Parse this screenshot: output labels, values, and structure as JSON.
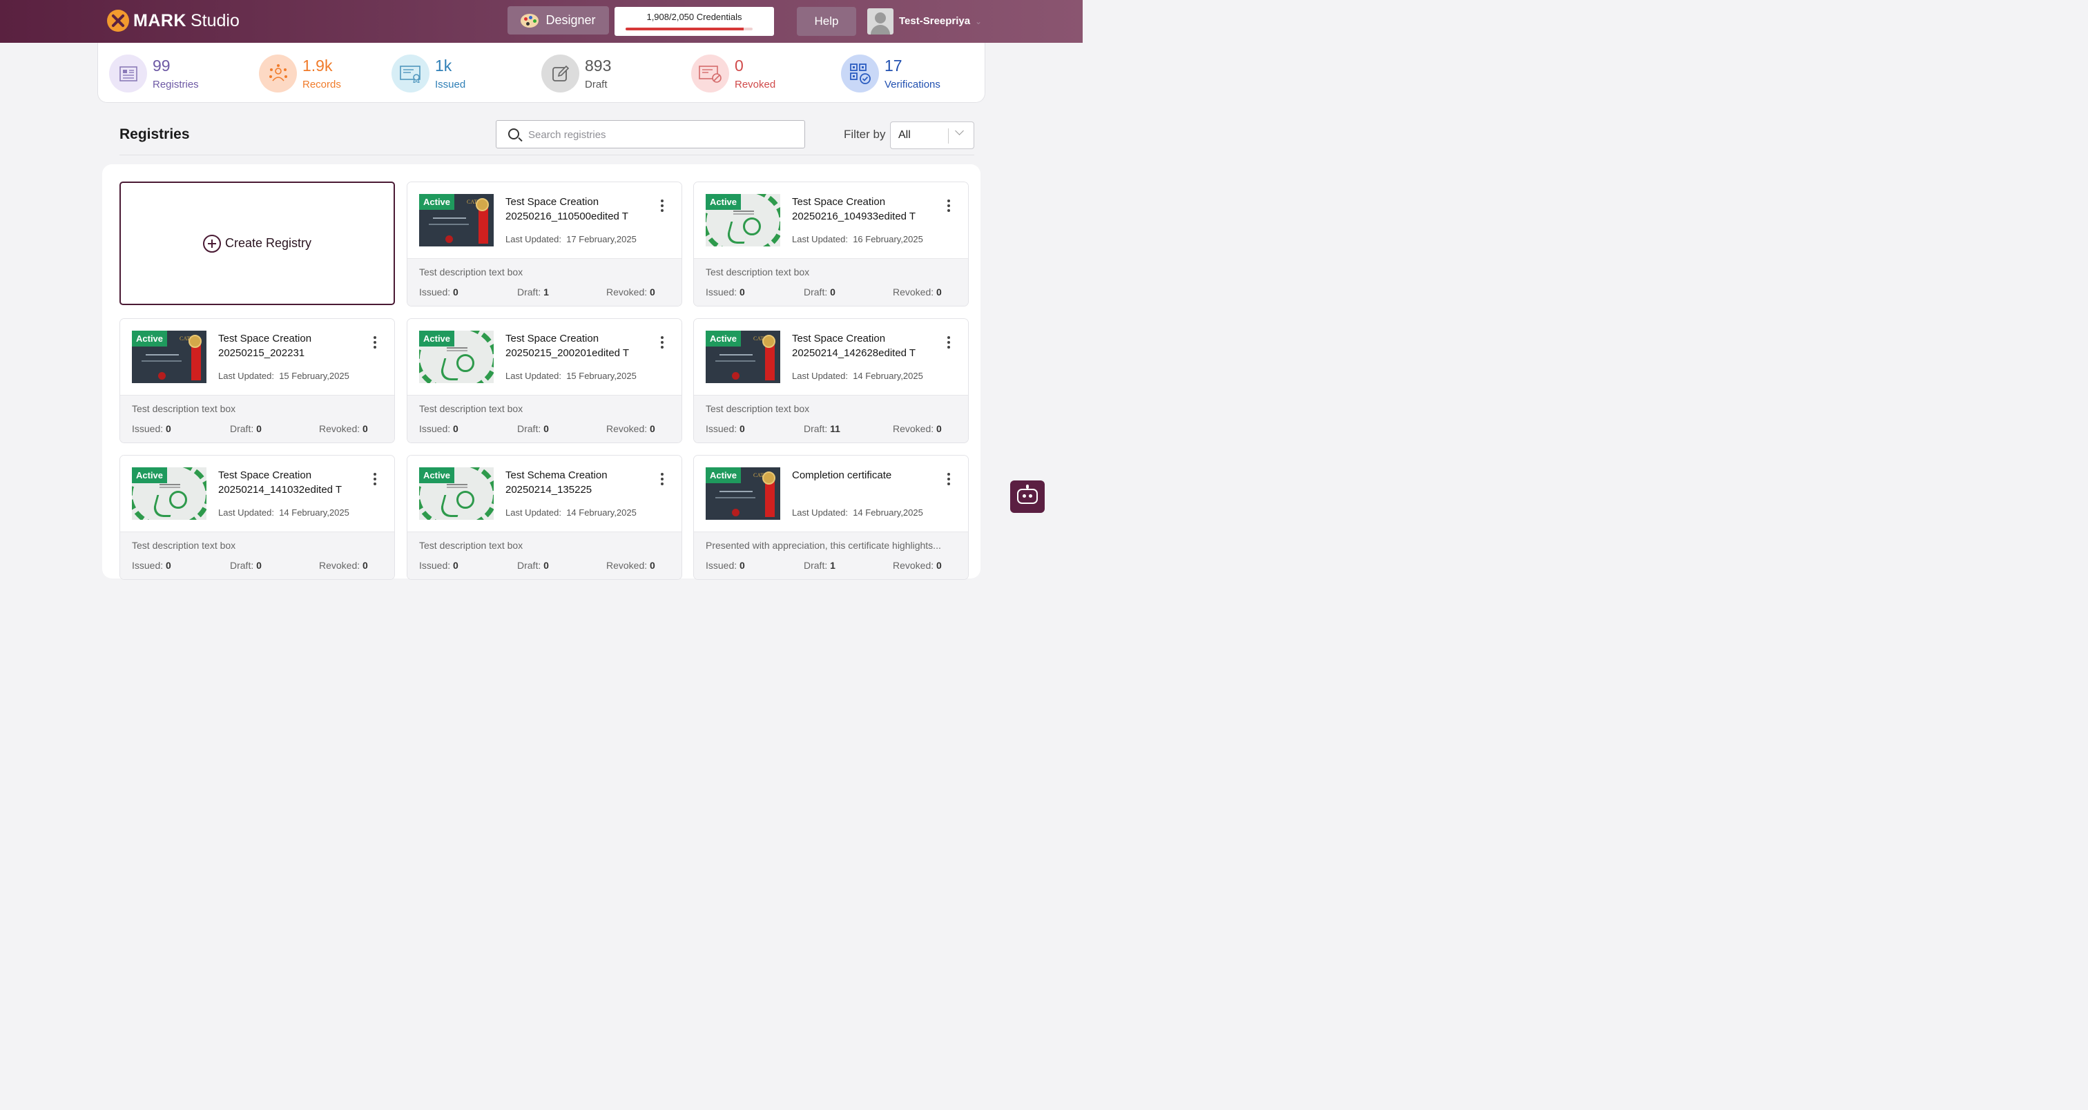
{
  "header": {
    "logo_bold": "MARK",
    "logo_light": "Studio",
    "designer_label": "Designer",
    "credentials_text": "1,908/2,050 Credentials",
    "credentials_used": 1908,
    "credentials_total": 2050,
    "credentials_fraction": 0.93,
    "help_label": "Help",
    "username": "Test-Sreepriya"
  },
  "stats": [
    {
      "value": "99",
      "label": "Registries",
      "color": "#6e5aa5",
      "icon": "registry-icon",
      "icon_bg": "#ece6f8"
    },
    {
      "value": "1.9k",
      "label": "Records",
      "color": "#f07b2a",
      "icon": "records-icon",
      "icon_bg": "#fdd9c4"
    },
    {
      "value": "1k",
      "label": "Issued",
      "color": "#2f7fb6",
      "icon": "issued-certificate-icon",
      "icon_bg": "#d7eef6"
    },
    {
      "value": "893",
      "label": "Draft",
      "color": "#555555",
      "icon": "draft-edit-icon",
      "icon_bg": "#dcdcdc"
    },
    {
      "value": "0",
      "label": "Revoked",
      "color": "#d04a4a",
      "icon": "revoked-icon",
      "icon_bg": "#fbdcdc"
    },
    {
      "value": "17",
      "label": "Verifications",
      "color": "#2150b0",
      "icon": "verification-qr-icon",
      "icon_bg": "#c9d8f7"
    }
  ],
  "registries": {
    "title": "Registries",
    "search_placeholder": "Search registries",
    "filter_label": "Filter by",
    "filter_value": "All",
    "create_label": "Create Registry",
    "updated_label": "Last Updated:",
    "issued_label": "Issued:",
    "draft_label": "Draft:",
    "revoked_label": "Revoked:",
    "cards": [
      {
        "status": "Active",
        "title": "Test Space Creation 20250216_110500edited T",
        "updated": "17 February,2025",
        "description": "Test description text box",
        "issued": "0",
        "draft": "1",
        "revoked": "0",
        "thumb": "dark"
      },
      {
        "status": "Active",
        "title": "Test Space Creation 20250216_104933edited T",
        "updated": "16 February,2025",
        "description": "Test description text box",
        "issued": "0",
        "draft": "0",
        "revoked": "0",
        "thumb": "light"
      },
      {
        "status": "Active",
        "title": "Test Space Creation 20250215_202231",
        "updated": "15 February,2025",
        "description": "Test description text box",
        "issued": "0",
        "draft": "0",
        "revoked": "0",
        "thumb": "dark"
      },
      {
        "status": "Active",
        "title": "Test Space Creation 20250215_200201edited T",
        "updated": "15 February,2025",
        "description": "Test description text box",
        "issued": "0",
        "draft": "0",
        "revoked": "0",
        "thumb": "light"
      },
      {
        "status": "Active",
        "title": "Test Space Creation 20250214_142628edited T",
        "updated": "14 February,2025",
        "description": "Test description text box",
        "issued": "0",
        "draft": "11",
        "revoked": "0",
        "thumb": "dark"
      },
      {
        "status": "Active",
        "title": "Test Space Creation 20250214_141032edited T",
        "updated": "14 February,2025",
        "description": "Test description text box",
        "issued": "0",
        "draft": "0",
        "revoked": "0",
        "thumb": "light"
      },
      {
        "status": "Active",
        "title": "Test Schema Creation 20250214_135225",
        "updated": "14 February,2025",
        "description": "Test description text box",
        "issued": "0",
        "draft": "0",
        "revoked": "0",
        "thumb": "light"
      },
      {
        "status": "Active",
        "title": "Completion certificate",
        "updated": "14 February,2025",
        "description": "Presented with appreciation, this certificate highlights...",
        "issued": "0",
        "draft": "1",
        "revoked": "0",
        "thumb": "dark"
      }
    ]
  }
}
